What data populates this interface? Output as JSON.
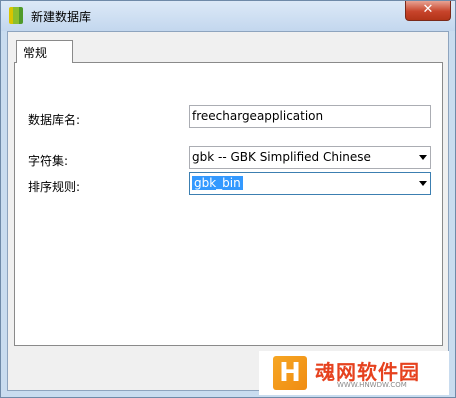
{
  "window": {
    "title": "新建数据库",
    "close_glyph": "✕"
  },
  "tabs": [
    {
      "label": "常规"
    }
  ],
  "form": {
    "db_name_label": "数据库名:",
    "db_name_value": "freechargeapplication",
    "charset_label": "字符集:",
    "charset_value": "gbk -- GBK Simplified Chinese",
    "collation_label": "排序规则:",
    "collation_value": "gbk_bin"
  },
  "watermark": {
    "logo_glyph": "H",
    "title": "魂网软件园",
    "subtitle": "WWW.HNWDW.COM"
  }
}
